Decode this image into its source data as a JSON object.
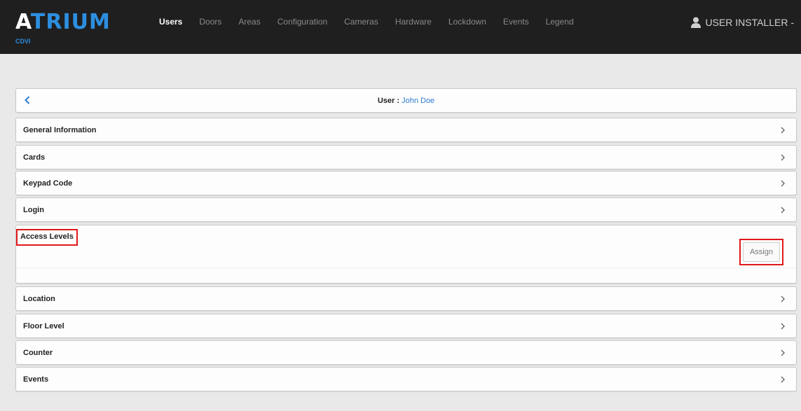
{
  "brand": {
    "logo_first": "A",
    "logo_rest": "TRIUM",
    "subtitle": "CDVI"
  },
  "nav": {
    "items": [
      {
        "label": "Users",
        "active": true
      },
      {
        "label": "Doors"
      },
      {
        "label": "Areas"
      },
      {
        "label": "Configuration"
      },
      {
        "label": "Cameras"
      },
      {
        "label": "Hardware"
      },
      {
        "label": "Lockdown"
      },
      {
        "label": "Events"
      },
      {
        "label": "Legend"
      }
    ],
    "user_menu_label": "USER INSTALLER -"
  },
  "header": {
    "prefix": "User : ",
    "user_name": "John Doe"
  },
  "sections": {
    "general_information": "General Information",
    "cards": "Cards",
    "keypad_code": "Keypad Code",
    "login": "Login",
    "access_levels": "Access Levels",
    "location": "Location",
    "floor_level": "Floor Level",
    "counter": "Counter",
    "events": "Events"
  },
  "access_levels": {
    "assign_label": "Assign"
  },
  "colors": {
    "navbar": "#1f1f1f",
    "accent": "#2d8fe0",
    "highlight": "#e0181b",
    "background": "#e9e9e9"
  }
}
